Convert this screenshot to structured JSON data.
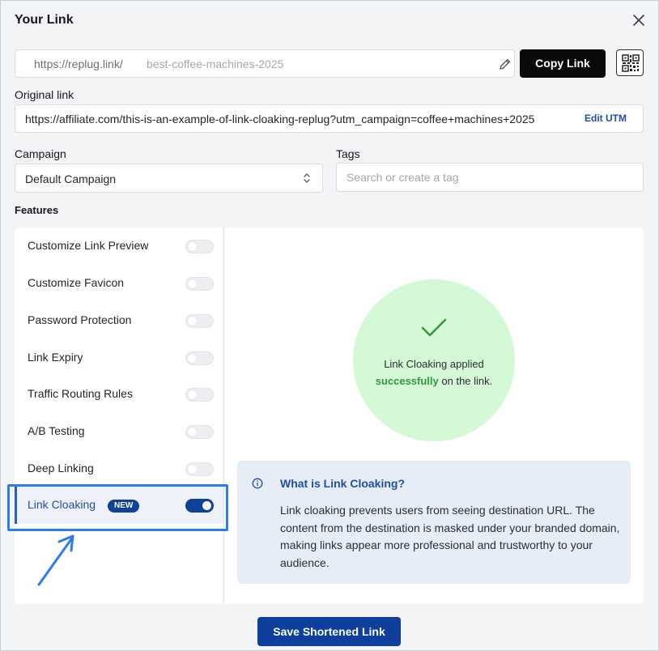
{
  "dialog": {
    "title": "Your Link",
    "close_icon": "close-icon"
  },
  "short_link": {
    "domain": "https://replug.link/",
    "slug": "best-coffee-machines-2025",
    "edit_icon": "pencil-icon",
    "copy_label": "Copy Link",
    "qr_icon": "qr-code-icon"
  },
  "original_link": {
    "label": "Original link",
    "value": "https://affiliate.com/this-is-an-example-of-link-cloaking-replug?utm_campaign=coffee+machines+2025",
    "edit_utm_label": "Edit UTM"
  },
  "campaign": {
    "label": "Campaign",
    "value": "Default Campaign",
    "icon": "chevron-up-down-icon"
  },
  "tags": {
    "label": "Tags",
    "placeholder": "Search or create a tag"
  },
  "features": {
    "label": "Features",
    "items": [
      {
        "label": "Customize Link Preview",
        "enabled": false
      },
      {
        "label": "Customize Favicon",
        "enabled": false
      },
      {
        "label": "Password Protection",
        "enabled": false
      },
      {
        "label": "Link Expiry",
        "enabled": false
      },
      {
        "label": "Traffic Routing Rules",
        "enabled": false
      },
      {
        "label": "A/B Testing",
        "enabled": false
      },
      {
        "label": "Deep Linking",
        "enabled": false
      },
      {
        "label": "Link Cloaking",
        "enabled": true,
        "badge": "NEW"
      }
    ]
  },
  "status": {
    "icon": "checkmark-icon",
    "text_before": "Link Cloaking applied",
    "text_highlight": "successfully",
    "text_after": "on the link."
  },
  "info": {
    "icon": "info-icon",
    "title": "What is Link Cloaking?",
    "body": "Link cloaking prevents users from seeing destination URL. The content from the destination is masked under your branded domain, making links appear more professional and trustworthy to your audience."
  },
  "save_label": "Save Shortened Link",
  "colors": {
    "primary": "#0f3f9c",
    "highlight_box": "#2e7af0",
    "success_circle": "#d5f8d6",
    "success_text": "#2e9b3c",
    "info_bg": "#e6edf7"
  }
}
